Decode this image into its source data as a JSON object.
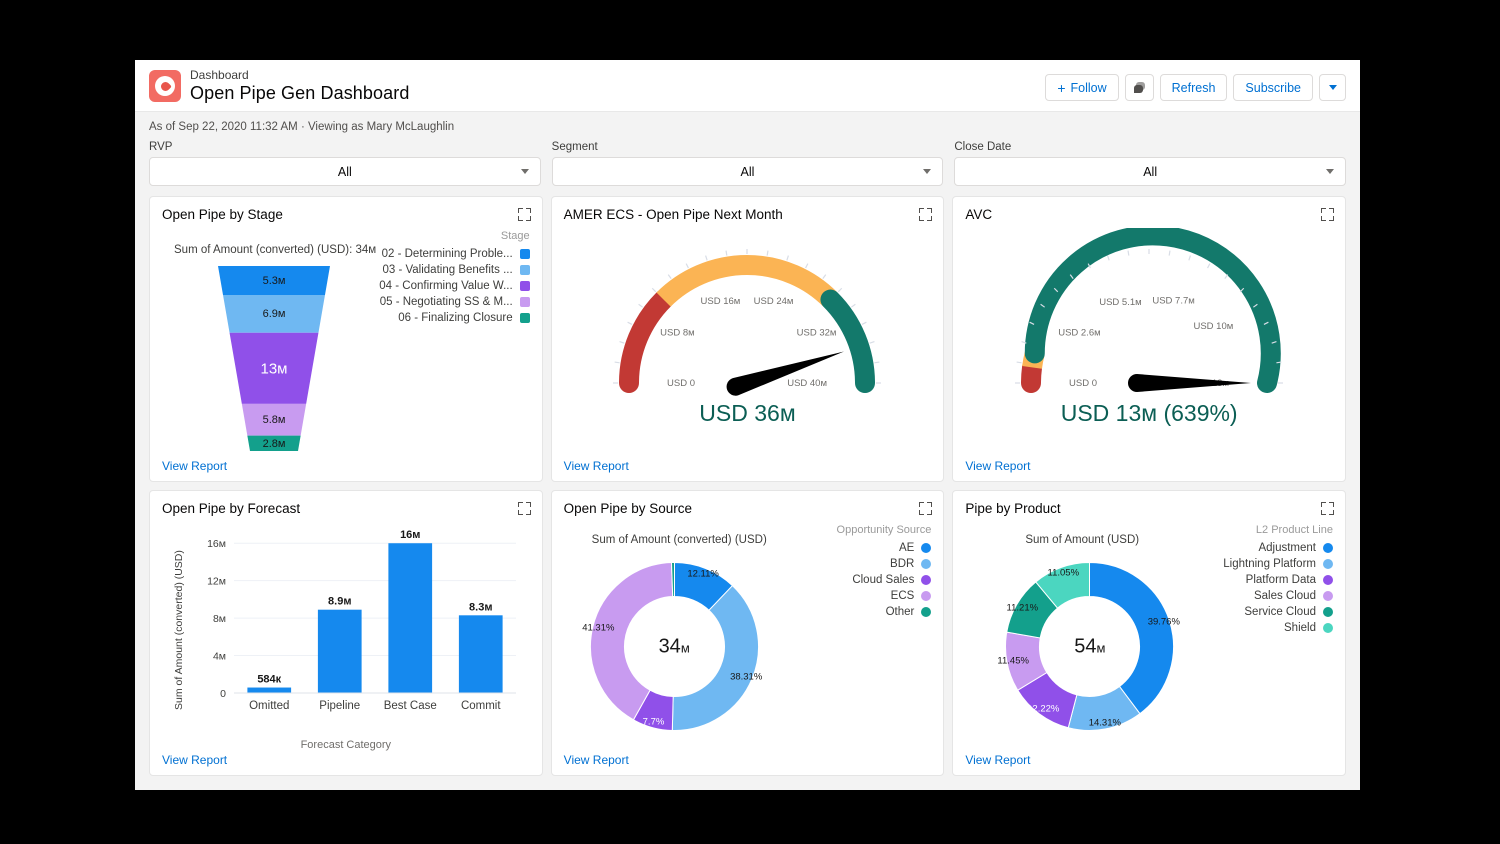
{
  "header": {
    "eyebrow": "Dashboard",
    "title": "Open Pipe Gen Dashboard",
    "app_icon": "dashboard-gauge-icon",
    "follow_label": "Follow",
    "comment_icon": "comment-icon",
    "refresh_label": "Refresh",
    "subscribe_label": "Subscribe",
    "more_caret_icon": "chevron-down-icon",
    "meta": "As of Sep 22, 2020 11:32 AM · Viewing as Mary McLaughlin"
  },
  "filters": [
    {
      "label": "RVP",
      "value": "All"
    },
    {
      "label": "Segment",
      "value": "All"
    },
    {
      "label": "Close Date",
      "value": "All"
    }
  ],
  "common": {
    "view_report": "View Report",
    "expand_icon": "expand-icon"
  },
  "colors": {
    "blue": "#1589EE",
    "light_blue": "#6FB8F2",
    "purple": "#9050E9",
    "light_purple": "#C89BF0",
    "teal": "#13A08C",
    "bright_teal": "#4BD6C0",
    "red": "#C23934",
    "orange": "#FBB454",
    "dark_teal": "#0B5E54",
    "link": "#0070d2"
  },
  "cards": {
    "open_pipe_by_stage": {
      "title": "Open Pipe by Stage",
      "caption": "Sum of Amount (converted) (USD): 34м",
      "legend_title": "Stage",
      "chart_data": {
        "type": "funnel",
        "title": "Open Pipe by Stage",
        "total": "34м",
        "measure": "Sum of Amount (converted) (USD)",
        "categories": [
          "02 - Determining Proble...",
          "03 - Validating Benefits ...",
          "04 - Confirming Value W...",
          "05 - Negotiating SS & M...",
          "06 - Finalizing Closure"
        ],
        "labels": [
          "5.3м",
          "6.9м",
          "13м",
          "5.8м",
          "2.8м"
        ],
        "values": [
          5.3,
          6.9,
          13,
          5.8,
          2.8
        ],
        "colors": [
          "#1589EE",
          "#6FB8F2",
          "#9050E9",
          "#C89BF0",
          "#13A08C"
        ]
      }
    },
    "amer_ecs_gauge": {
      "title": "AMER ECS - Open Pipe Next Month",
      "chart_data": {
        "type": "gauge",
        "title": "AMER ECS - Open Pipe Next Month",
        "value": 36,
        "value_label": "USD 36м",
        "min": 0,
        "max": 40,
        "tick_labels": [
          "USD 0",
          "USD 8м",
          "USD 16м",
          "USD 24м",
          "USD 32м",
          "USD 40м"
        ],
        "tick_values": [
          0,
          8,
          16,
          24,
          32,
          40
        ],
        "bands": [
          {
            "from": 0,
            "to": 10,
            "color": "#C23934"
          },
          {
            "from": 10,
            "to": 30,
            "color": "#FBB454"
          },
          {
            "from": 30,
            "to": 40,
            "color": "#13796B"
          }
        ]
      }
    },
    "avc_gauge": {
      "title": "AVC",
      "chart_data": {
        "type": "gauge",
        "title": "AVC",
        "value": 13,
        "value_label": "USD 13м (639%)",
        "min": 0,
        "max": 13,
        "tick_labels": [
          "USD 0",
          "USD 2.6м",
          "USD 5.1м",
          "USD 7.7м",
          "USD 10м",
          "USD 13м"
        ],
        "tick_values": [
          0,
          2.6,
          5.1,
          7.7,
          10,
          13
        ],
        "bands": [
          {
            "from": 0,
            "to": 0.55,
            "color": "#C23934"
          },
          {
            "from": 0.55,
            "to": 1.05,
            "color": "#FBB454"
          },
          {
            "from": 1.05,
            "to": 13,
            "color": "#13796B"
          }
        ]
      }
    },
    "open_pipe_by_forecast": {
      "title": "Open Pipe by Forecast",
      "chart_data": {
        "type": "bar",
        "title": "Open Pipe by Forecast",
        "categories": [
          "Omitted",
          "Pipeline",
          "Best Case",
          "Commit"
        ],
        "values": [
          0.584,
          8.9,
          16,
          8.3
        ],
        "data_labels": [
          "584к",
          "8.9м",
          "16м",
          "8.3м"
        ],
        "xlabel": "Forecast Category",
        "ylabel": "Sum of Amount (converted) (USD)",
        "ytick_labels": [
          "0",
          "4м",
          "8м",
          "12м",
          "16м"
        ],
        "ytick_values": [
          0,
          4,
          8,
          12,
          16
        ],
        "ylim": [
          0,
          17.2
        ],
        "grid": true,
        "bar_color": "#1589EE"
      }
    },
    "open_pipe_by_source": {
      "title": "Open Pipe by Source",
      "caption": "Sum of Amount (converted) (USD)",
      "legend_title": "Opportunity Source",
      "chart_data": {
        "type": "pie",
        "title": "Open Pipe by Source",
        "center_label": "34м",
        "categories": [
          "AE",
          "BDR",
          "Cloud Sales",
          "ECS",
          "Other"
        ],
        "values": [
          12.11,
          38.31,
          7.7,
          41.31,
          0.57
        ],
        "data_labels": [
          "12.11%",
          "38.31%",
          "7.7%",
          "41.31%",
          ""
        ],
        "colors": [
          "#1589EE",
          "#6FB8F2",
          "#9050E9",
          "#C89BF0",
          "#13A08C"
        ],
        "legend_position": "right"
      }
    },
    "pipe_by_product": {
      "title": "Pipe by Product",
      "caption": "Sum of Amount (USD)",
      "legend_title": "L2 Product Line",
      "chart_data": {
        "type": "pie",
        "title": "Pipe by Product",
        "center_label": "54м",
        "categories": [
          "Adjustment",
          "Lightning Platform",
          "Platform Data",
          "Sales Cloud",
          "Service Cloud",
          "Shield"
        ],
        "values": [
          39.76,
          14.31,
          12.22,
          11.45,
          11.21,
          11.05
        ],
        "data_labels": [
          "39.76%",
          "14.31%",
          "12.22%",
          "11.45%",
          "11.21%",
          "11.05%"
        ],
        "colors": [
          "#1589EE",
          "#6FB8F2",
          "#9050E9",
          "#C89BF0",
          "#13A08C",
          "#4BD6C0"
        ],
        "legend_position": "right"
      }
    }
  }
}
